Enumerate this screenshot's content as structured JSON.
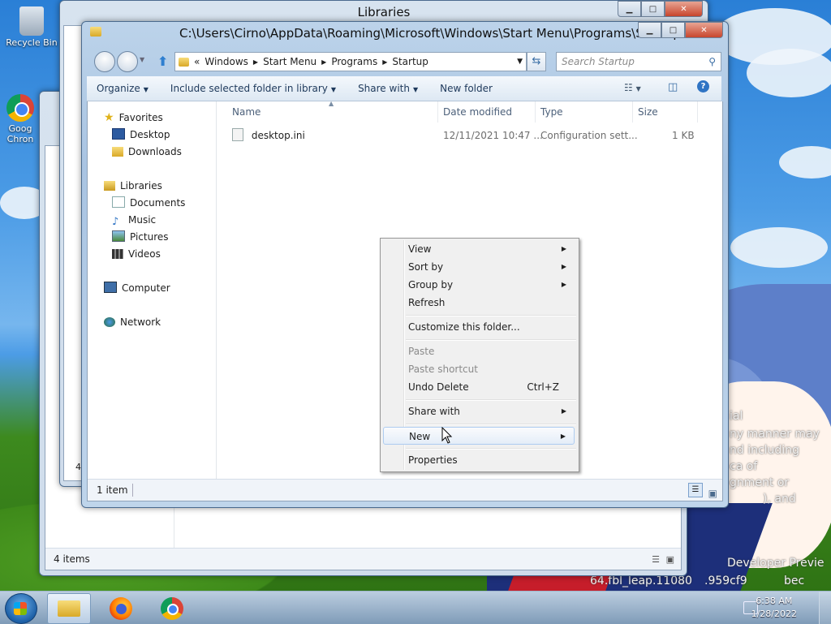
{
  "desktop": {
    "icons": [
      {
        "label": "Recycle Bin"
      },
      {
        "label": "Goog Chron"
      }
    ],
    "watermark_lines": [
      "ial",
      "ny manner may",
      "nd including",
      "ca of",
      "gnment or",
      "), and",
      "Developer Previe",
      "64.fbl_leap.11080",
      ".959cf9",
      "bec"
    ]
  },
  "windows": {
    "back": {
      "title": "Libraries",
      "status": "4 items",
      "partial_status": "4"
    },
    "front": {
      "title": "C:\\Users\\Cirno\\AppData\\Roaming\\Microsoft\\Windows\\Start Menu\\Programs\\Startup",
      "breadcrumb": {
        "overflow": "«",
        "items": [
          "Windows",
          "Start Menu",
          "Programs",
          "Startup"
        ]
      },
      "search_placeholder": "Search Startup",
      "toolbar": {
        "organize": "Organize",
        "include": "Include selected folder in library",
        "share": "Share with",
        "new_folder": "New folder"
      },
      "nav": {
        "favorites": "Favorites",
        "desktop": "Desktop",
        "downloads": "Downloads",
        "libraries": "Libraries",
        "documents": "Documents",
        "music": "Music",
        "pictures": "Pictures",
        "videos": "Videos",
        "computer": "Computer",
        "network": "Network"
      },
      "columns": {
        "name": "Name",
        "date": "Date modified",
        "type": "Type",
        "size": "Size"
      },
      "files": [
        {
          "name": "desktop.ini",
          "date": "12/11/2021 10:47 ...",
          "type": "Configuration sett...",
          "size": "1 KB"
        }
      ],
      "status": "1 item"
    }
  },
  "context_menu": {
    "view": "View",
    "sort_by": "Sort by",
    "group_by": "Group by",
    "refresh": "Refresh",
    "customize": "Customize this folder...",
    "paste": "Paste",
    "paste_shortcut": "Paste shortcut",
    "undo_delete": "Undo Delete",
    "undo_shortcut": "Ctrl+Z",
    "share_with": "Share with",
    "new": "New",
    "properties": "Properties",
    "highlighted": "New"
  },
  "taskbar": {
    "time": "6:38 AM",
    "date": "1/28/2022"
  }
}
